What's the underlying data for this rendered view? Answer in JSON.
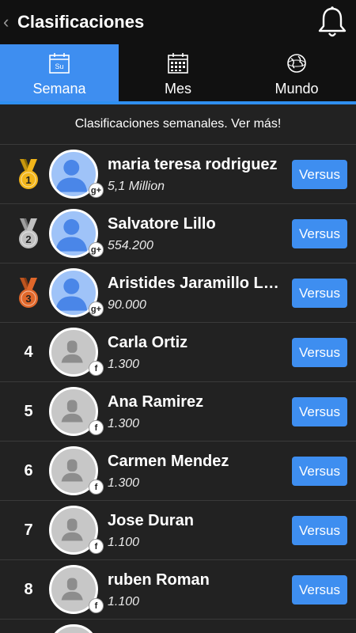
{
  "header": {
    "back_glyph": "‹",
    "title": "Clasificaciones",
    "notification_icon": "bell-icon"
  },
  "tabs": [
    {
      "label": "Semana",
      "icon": "calendar-su-icon",
      "icon_text": "Su",
      "active": true
    },
    {
      "label": "Mes",
      "icon": "calendar-month-icon",
      "active": false
    },
    {
      "label": "Mundo",
      "icon": "globe-icon",
      "active": false
    }
  ],
  "subtitle": "Clasificaciones semanales. Ver más!",
  "versus_label": "Versus",
  "colors": {
    "accent": "#3e8ef0",
    "gold": "#f2b51a",
    "silver": "#bfbfbf",
    "bronze": "#e0672a"
  },
  "players": [
    {
      "rank": "1",
      "medal": "gold",
      "name": "maria teresa rodriguez",
      "score": "5,1 Million",
      "network": "g+"
    },
    {
      "rank": "2",
      "medal": "silver",
      "name": "Salvatore Lillo",
      "score": "554.200",
      "network": "g+"
    },
    {
      "rank": "3",
      "medal": "bronze",
      "name": "Aristides Jaramillo Lopez",
      "score": "90.000",
      "network": "g+"
    },
    {
      "rank": "4",
      "medal": null,
      "name": "Carla  Ortiz",
      "score": "1.300",
      "network": "f"
    },
    {
      "rank": "5",
      "medal": null,
      "name": "Ana  Ramirez",
      "score": "1.300",
      "network": "f"
    },
    {
      "rank": "6",
      "medal": null,
      "name": "Carmen  Mendez",
      "score": "1.300",
      "network": "f"
    },
    {
      "rank": "7",
      "medal": null,
      "name": "Jose  Duran",
      "score": "1.100",
      "network": "f"
    },
    {
      "rank": "8",
      "medal": null,
      "name": "ruben  Roman",
      "score": "1.100",
      "network": "f"
    }
  ]
}
